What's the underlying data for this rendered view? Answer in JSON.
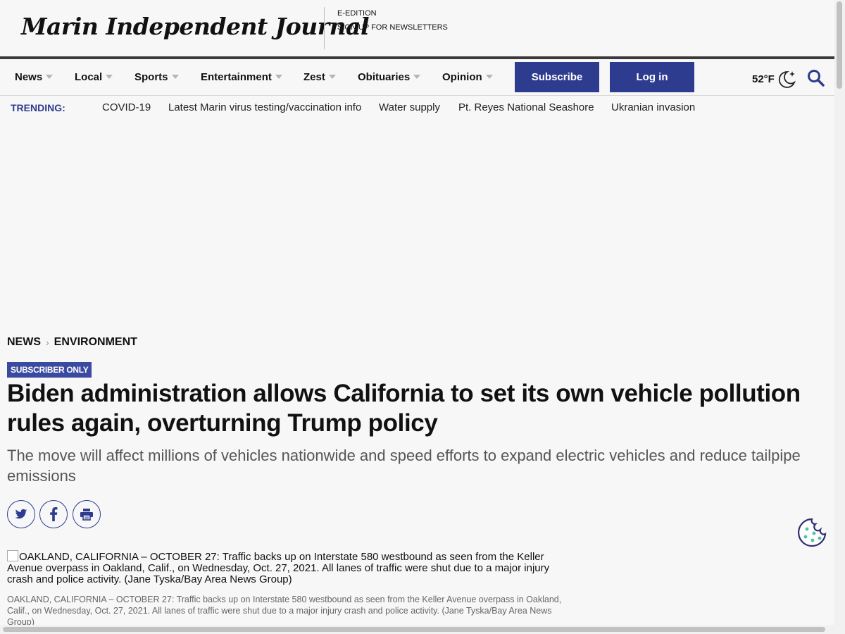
{
  "header": {
    "logo_text": "Marin Independent Journal",
    "links": [
      "E-EDITION",
      "SIGN UP FOR NEWSLETTERS"
    ]
  },
  "nav": {
    "items": [
      "News",
      "Local",
      "Sports",
      "Entertainment",
      "Zest",
      "Obituaries",
      "Opinion"
    ],
    "subscribe_label": "Subscribe",
    "login_label": "Log in",
    "temperature": "52°F"
  },
  "trending": {
    "label": "TRENDING:",
    "items": [
      "COVID-19",
      "Latest Marin virus testing/vaccination info",
      "Water supply",
      "Pt. Reyes National Seashore",
      "Ukranian invasion"
    ]
  },
  "article": {
    "breadcrumb": [
      "NEWS",
      "ENVIRONMENT"
    ],
    "badge": "SUBSCRIBER ONLY",
    "headline": "Biden administration allows California to set its own vehicle pollution rules again, overturning Trump policy",
    "subhead": "The move will affect millions of vehicles nationwide and speed efforts to expand electric vehicles and reduce tailpipe emissions",
    "image_alt": "OAKLAND, CALIFORNIA – OCTOBER 27: Traffic backs up on Interstate 580 westbound as seen from the Keller Avenue overpass in Oakland, Calif., on Wednesday, Oct. 27, 2021. All lanes of traffic were shut due to a major injury crash and police activity. (Jane Tyska/Bay Area News Group)",
    "caption": "OAKLAND, CALIFORNIA – OCTOBER 27: Traffic backs up on Interstate 580 westbound as seen from the Keller Avenue overpass in Oakland, Calif., on Wednesday, Oct. 27, 2021. All lanes of traffic were shut due to a major injury crash and police activity. (Jane Tyska/Bay Area News Group)"
  },
  "colors": {
    "brand_blue": "#2e3c8f",
    "badge_blue": "#3a4aa0",
    "cookie_accent": "#4fc3a1"
  },
  "icons": [
    "twitter-icon",
    "facebook-icon",
    "print-icon",
    "moon-icon",
    "search-icon",
    "cookie-icon"
  ]
}
